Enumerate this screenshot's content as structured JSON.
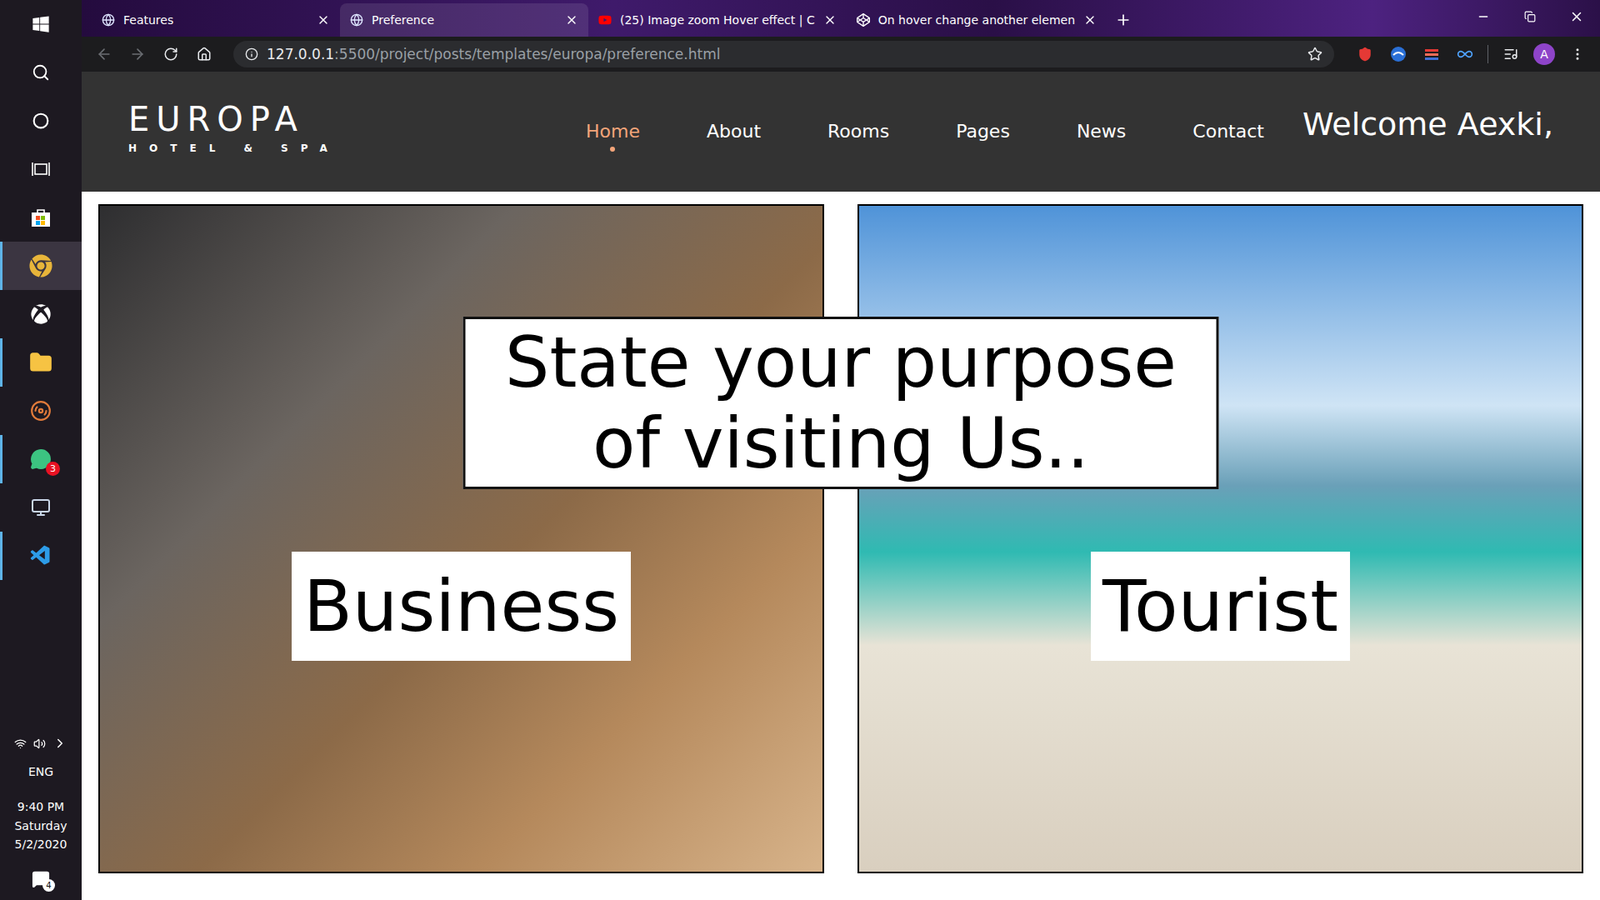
{
  "taskbar": {
    "apps": [
      {
        "kind": "start",
        "running": false,
        "selected": false
      },
      {
        "kind": "search",
        "running": false,
        "selected": false
      },
      {
        "kind": "cortana",
        "running": false,
        "selected": false
      },
      {
        "kind": "taskview",
        "running": false,
        "selected": false
      },
      {
        "kind": "store",
        "running": false,
        "selected": false
      },
      {
        "kind": "chrome",
        "running": true,
        "selected": true
      },
      {
        "kind": "xbox",
        "running": false,
        "selected": false
      },
      {
        "kind": "files",
        "running": true,
        "selected": false
      },
      {
        "kind": "groove",
        "running": false,
        "selected": false
      },
      {
        "kind": "chat",
        "running": true,
        "selected": false,
        "badge": "3"
      },
      {
        "kind": "devices",
        "running": false,
        "selected": false
      },
      {
        "kind": "vscode",
        "running": true,
        "selected": false
      }
    ],
    "tray": {
      "language": "ENG",
      "time": "9:40 PM",
      "day": "Saturday",
      "date": "5/2/2020",
      "notifications": "4"
    }
  },
  "browser": {
    "tabs": [
      {
        "label": "Features",
        "selected": false,
        "kind": "globe"
      },
      {
        "label": "Preference",
        "selected": true,
        "kind": "globe"
      },
      {
        "label": "(25) Image zoom Hover effect | C",
        "selected": false,
        "kind": "youtube"
      },
      {
        "label": "On hover change another elemen",
        "selected": false,
        "kind": "codepen"
      }
    ],
    "url": {
      "host": "127.0.0.1",
      "path": ":5500/project/posts/templates/europa/preference.html"
    },
    "profile": "A"
  },
  "page": {
    "logo": {
      "name": "EUROPA",
      "tagline": "HOTEL & SPA"
    },
    "nav": [
      {
        "label": "Home",
        "selected": true
      },
      {
        "label": "About",
        "selected": false
      },
      {
        "label": "Rooms",
        "selected": false
      },
      {
        "label": "Pages",
        "selected": false
      },
      {
        "label": "News",
        "selected": false
      },
      {
        "label": "Contact",
        "selected": false
      }
    ],
    "welcome": "Welcome Aexki,",
    "prompt": "State your purpose of visiting Us..",
    "options": [
      {
        "label": "Business",
        "kind": "business"
      },
      {
        "label": "Tourist",
        "kind": "tourist"
      }
    ]
  }
}
